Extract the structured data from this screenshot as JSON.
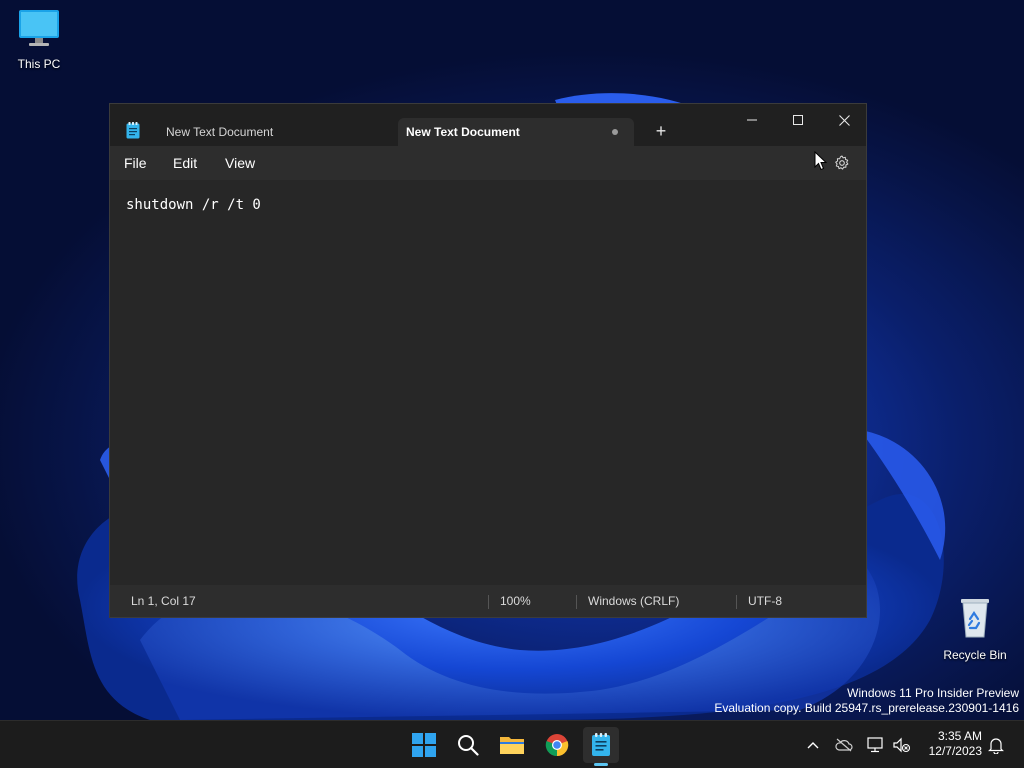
{
  "desktop": {
    "icons": [
      {
        "label": "This PC"
      },
      {
        "label": "Recycle Bin"
      }
    ],
    "watermark": {
      "line1": "Windows 11 Pro Insider Preview",
      "line2": "Evaluation copy. Build 25947.rs_prerelease.230901-1416"
    }
  },
  "notepad": {
    "tabs": [
      {
        "title": "New Text Document",
        "active": false,
        "unsaved": false
      },
      {
        "title": "New Text Document",
        "active": true,
        "unsaved": true
      }
    ],
    "new_tab_label": "+",
    "menu": [
      "File",
      "Edit",
      "View"
    ],
    "content": "shutdown /r /t 0",
    "status": {
      "position": "Ln 1, Col 17",
      "zoom": "100%",
      "line_ending": "Windows (CRLF)",
      "encoding": "UTF-8"
    }
  },
  "taskbar": {
    "apps": [
      "start-icon",
      "search-icon",
      "file-explorer-icon",
      "chrome-icon",
      "notepad-icon"
    ],
    "active_app": "notepad",
    "clock": {
      "time": "3:35 AM",
      "date": "12/7/2023"
    }
  },
  "colors": {
    "window_bg": "#272727",
    "titlebar_bg": "#202020",
    "bar_bg": "#2d2d2d",
    "taskbar_bg": "#1c1c1c",
    "accent": "#5cc5f2"
  }
}
